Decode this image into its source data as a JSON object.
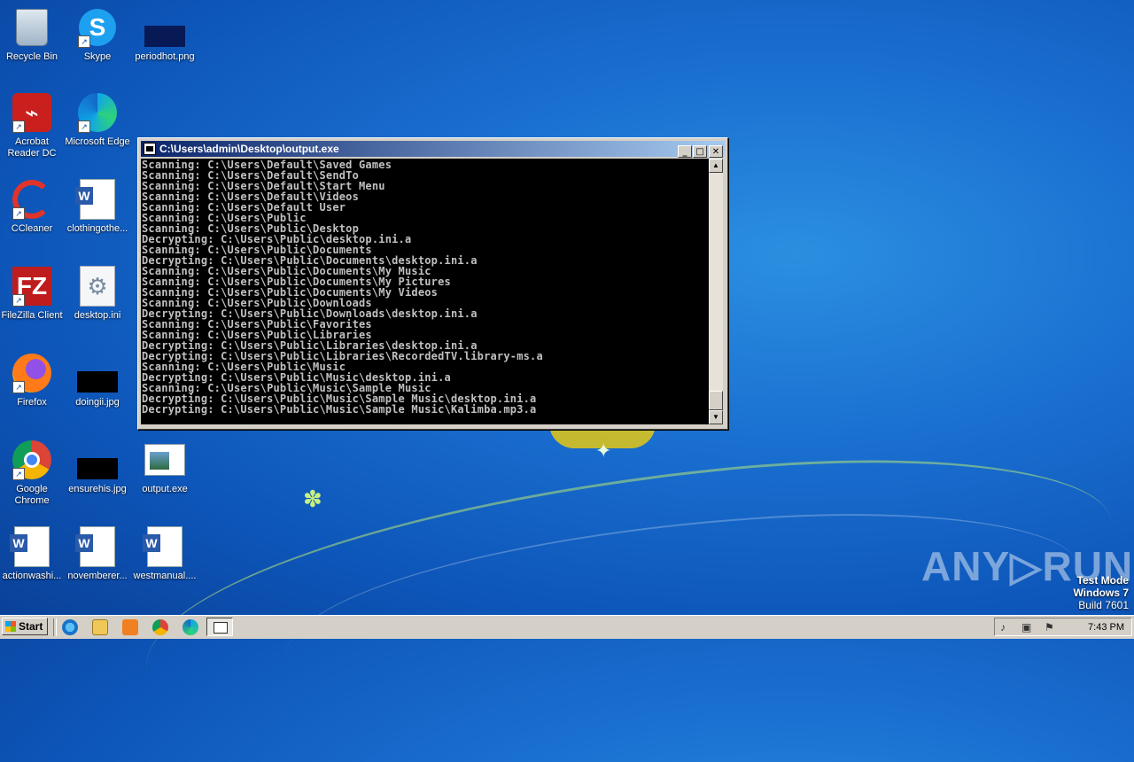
{
  "desktop": {
    "icons": [
      {
        "label": "Recycle Bin"
      },
      {
        "label": "Skype"
      },
      {
        "label": "periodhot.png"
      },
      {
        "label": "Acrobat Reader DC"
      },
      {
        "label": "Microsoft Edge"
      },
      {
        "label": "CCleaner"
      },
      {
        "label": "clothingothe..."
      },
      {
        "label": "FileZilla Client"
      },
      {
        "label": "desktop.ini"
      },
      {
        "label": "Firefox"
      },
      {
        "label": "doingii.jpg"
      },
      {
        "label": "Google Chrome"
      },
      {
        "label": "ensurehis.jpg"
      },
      {
        "label": "output.exe"
      },
      {
        "label": "actionwashi..."
      },
      {
        "label": "novemberer..."
      },
      {
        "label": "westmanual...."
      }
    ]
  },
  "console_window": {
    "title": "C:\\Users\\admin\\Desktop\\output.exe",
    "buttons": {
      "minimize": "_",
      "maximize": "□",
      "close": "✕"
    },
    "lines": [
      "Scanning: C:\\Users\\Default\\Saved Games",
      "Scanning: C:\\Users\\Default\\SendTo",
      "Scanning: C:\\Users\\Default\\Start Menu",
      "Scanning: C:\\Users\\Default\\Videos",
      "Scanning: C:\\Users\\Default User",
      "Scanning: C:\\Users\\Public",
      "Scanning: C:\\Users\\Public\\Desktop",
      "Decrypting: C:\\Users\\Public\\desktop.ini.a",
      "Scanning: C:\\Users\\Public\\Documents",
      "Decrypting: C:\\Users\\Public\\Documents\\desktop.ini.a",
      "Scanning: C:\\Users\\Public\\Documents\\My Music",
      "Scanning: C:\\Users\\Public\\Documents\\My Pictures",
      "Scanning: C:\\Users\\Public\\Documents\\My Videos",
      "Scanning: C:\\Users\\Public\\Downloads",
      "Decrypting: C:\\Users\\Public\\Downloads\\desktop.ini.a",
      "Scanning: C:\\Users\\Public\\Favorites",
      "Scanning: C:\\Users\\Public\\Libraries",
      "Decrypting: C:\\Users\\Public\\Libraries\\desktop.ini.a",
      "Decrypting: C:\\Users\\Public\\Libraries\\RecordedTV.library-ms.a",
      "Scanning: C:\\Users\\Public\\Music",
      "Decrypting: C:\\Users\\Public\\Music\\desktop.ini.a",
      "Scanning: C:\\Users\\Public\\Music\\Sample Music",
      "Decrypting: C:\\Users\\Public\\Music\\Sample Music\\desktop.ini.a",
      "Decrypting: C:\\Users\\Public\\Music\\Sample Music\\Kalimba.mp3.a"
    ]
  },
  "watermark": {
    "brand": "ANY▷RUN"
  },
  "system_info": {
    "line1": "Test Mode",
    "line2": "Windows 7",
    "line3": "Build 7601"
  },
  "taskbar": {
    "start_label": "Start",
    "clock": "7:43 PM"
  }
}
